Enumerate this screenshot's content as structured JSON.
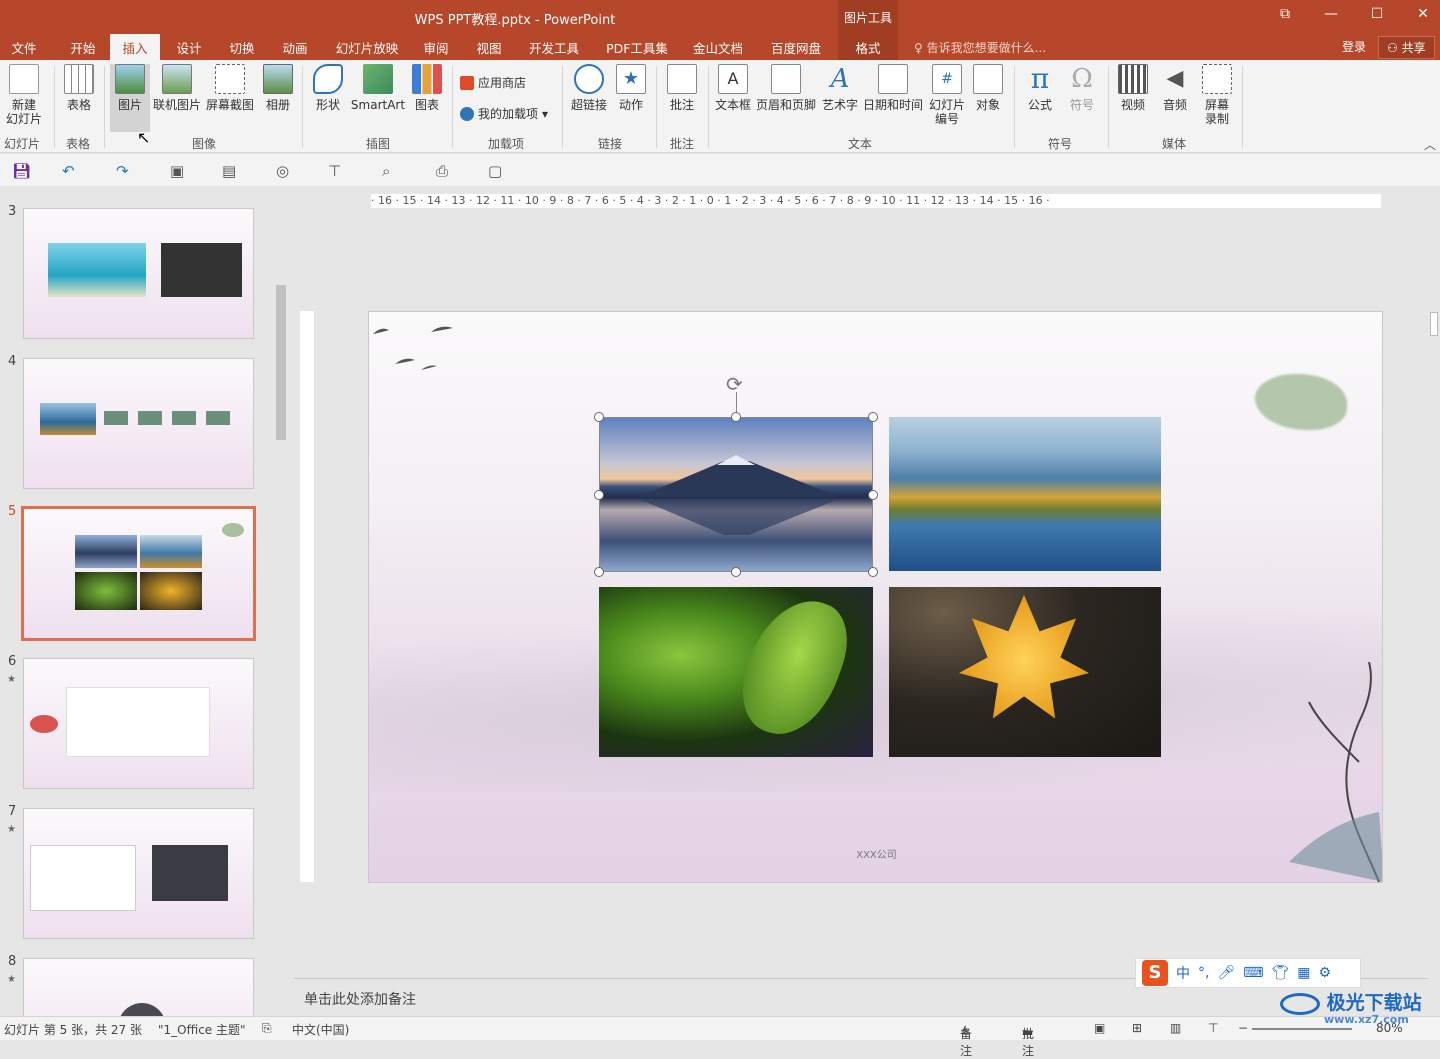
{
  "window": {
    "title": "WPS PPT教程.pptx - PowerPoint",
    "context_tab_group": "图片工具",
    "restore": "⧉",
    "minimize": "—",
    "maximize": "☐",
    "close": "✕"
  },
  "tabs": [
    "文件",
    "开始",
    "插入",
    "设计",
    "切换",
    "动画",
    "幻灯片放映",
    "审阅",
    "视图",
    "开发工具",
    "PDF工具集",
    "金山文档",
    "百度网盘",
    "格式"
  ],
  "active_tab": "插入",
  "tell_me": "告诉我您想要做什么...",
  "account": {
    "login": "登录",
    "share": "共享"
  },
  "ribbon": {
    "new_slide": "新建\n幻灯片",
    "group_slides": "幻灯片",
    "table": "表格",
    "group_table": "表格",
    "picture": "图片",
    "online_picture": "联机图片",
    "screenshot": "屏幕截图",
    "album": "相册",
    "group_images": "图像",
    "shapes": "形状",
    "smartart": "SmartArt",
    "chart": "图表",
    "group_illustrations": "插图",
    "app_store": "应用商店",
    "my_addins": "我的加载项",
    "group_addins": "加载项",
    "hyperlink": "超链接",
    "action": "动作",
    "group_links": "链接",
    "comment": "批注",
    "group_comments": "批注",
    "textbox": "文本框",
    "header_footer": "页眉和页脚",
    "wordart": "艺术字",
    "datetime": "日期和时间",
    "slide_number": "幻灯片\n编号",
    "object": "对象",
    "group_text": "文本",
    "equation": "公式",
    "symbol": "符号",
    "group_symbols": "符号",
    "video": "视频",
    "audio": "音频",
    "screen_recording": "屏幕\n录制",
    "group_media": "媒体"
  },
  "ruler_text": "· 16 · 15 · 14 · 13 · 12 · 11 · 10 · 9 · 8 · 7 · 6 · 5 · 4 · 3 · 2 · 1 · 0 · 1 · 2 · 3 · 4 · 5 · 6 · 7 · 8 · 9 · 10 · 11 · 12 · 13 · 14 · 15 · 16 ·",
  "thumbnails": [
    {
      "num": "3",
      "star": ""
    },
    {
      "num": "4",
      "star": ""
    },
    {
      "num": "5",
      "star": ""
    },
    {
      "num": "6",
      "star": "★"
    },
    {
      "num": "7",
      "star": "★"
    },
    {
      "num": "8",
      "star": "★"
    }
  ],
  "slide": {
    "company": "XXX公司"
  },
  "notes_placeholder": "单击此处添加备注",
  "status": {
    "slide_info": "幻灯片 第 5 张，共 27 张",
    "theme": "\"1_Office 主题\"",
    "language": "中文(中国)",
    "notes": "备注",
    "comments": "批注",
    "zoom": "80%"
  },
  "ime": {
    "lang": "中"
  },
  "watermark": {
    "name": "极光下载站",
    "url": "www.xz7.com"
  },
  "colors": {
    "accent": "#b7472a",
    "selection": "#e06f4f"
  }
}
